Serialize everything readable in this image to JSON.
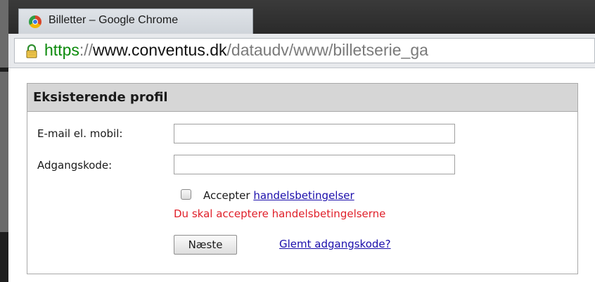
{
  "window": {
    "title": "Billetter – Google Chrome"
  },
  "address_bar": {
    "scheme": "https",
    "separator": "://",
    "host": "www.conventus.dk",
    "path": "/dataudv/www/billetserie_ga",
    "scheme_color": "#0b8a0b"
  },
  "form": {
    "title": "Eksisterende profil",
    "email_label": "E-mail el. mobil:",
    "email_value": "",
    "password_label": "Adgangskode:",
    "password_value": "",
    "accept_label": "Accepter",
    "accept_link": "handelsbetingelser",
    "accept_checked": false,
    "error_message": "Du skal acceptere handelsbetingelserne",
    "error_color": "#e0202a",
    "next_button": "Næste",
    "forgot_link": "Glemt adgangskode?",
    "link_color": "#1a0dab"
  },
  "icons": {
    "tab_icon": "chrome-icon",
    "secure_icon": "lock-icon"
  }
}
